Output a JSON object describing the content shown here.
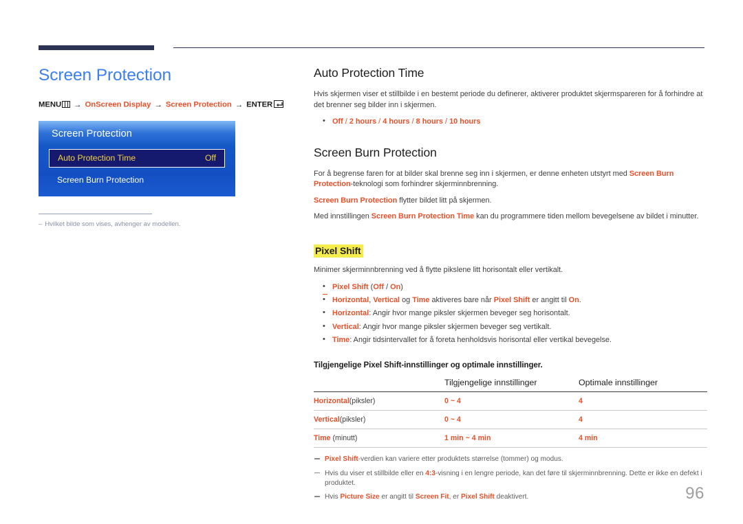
{
  "top_bar": {
    "present": true
  },
  "left": {
    "page_title": "Screen Protection",
    "breadcrumb": {
      "menu_label": "MENU",
      "menu_icon": "menu-bars-icon",
      "arrow1": "→",
      "item1": "OnScreen Display",
      "arrow2": "→",
      "item2": "Screen Protection",
      "arrow3": "→",
      "enter_label": "ENTER",
      "enter_icon": "enter-return-icon"
    },
    "osd": {
      "title": "Screen Protection",
      "rows": [
        {
          "label": "Auto Protection Time",
          "value": "Off",
          "selected": true
        },
        {
          "label": "Screen Burn Protection",
          "value": "",
          "selected": false
        }
      ]
    },
    "note": {
      "dash": "–",
      "text": "Hvilket bilde som vises, avhenger av modellen."
    }
  },
  "right": {
    "section1": {
      "heading": "Auto Protection Time",
      "paragraph": "Hvis skjermen viser et stillbilde i en bestemt periode du definerer, aktiverer produktet skjermspareren for å forhindre at det brenner seg bilder inn i skjermen.",
      "bullet": {
        "opt1": "Off",
        "sep1": " / ",
        "opt2": "2 hours",
        "sep2": " / ",
        "opt3": "4 hours",
        "sep3": " / ",
        "opt4": "8 hours",
        "sep4": " / ",
        "opt5": "10 hours"
      }
    },
    "section2": {
      "heading": "Screen Burn Protection",
      "p1_a": "For å begrense faren for at bilder skal brenne seg inn i skjermen, er denne enheten utstyrt med ",
      "p1_term": "Screen Burn Protection",
      "p1_b": "-teknologi som forhindrer skjerminnbrenning.",
      "p2_term": "Screen Burn Protection",
      "p2_b": " flytter bildet litt på skjermen.",
      "p3_a": "Med innstillingen ",
      "p3_term": "Screen Burn Protection Time",
      "p3_b": " kan du programmere tiden mellom bevegelsene av bildet i minutter."
    },
    "pixel_shift": {
      "heading": "Pixel Shift",
      "intro": "Minimer skjerminnbrenning ved å flytte pikslene litt horisontalt eller vertikalt.",
      "b1_term": "Pixel Shift",
      "b1_paren_open": " (",
      "b1_off": "Off",
      "b1_slash": " / ",
      "b1_on": "On",
      "b1_paren_close": ")",
      "sub_t1": "Horizontal",
      "sub_c1": ", ",
      "sub_t2": "Vertical",
      "sub_mid": " og ",
      "sub_t3": "Time",
      "sub_text": " aktiveres bare når ",
      "sub_t4": "Pixel Shift",
      "sub_text2": " er angitt til ",
      "sub_t5": "On",
      "sub_end": ".",
      "b2_term": "Horizontal",
      "b2_text": ": Angir hvor mange piksler skjermen beveger seg horisontalt.",
      "b3_term": "Vertical",
      "b3_text": ": Angir hvor mange piksler skjermen beveger seg vertikalt.",
      "b4_term": "Time",
      "b4_text": ": Angir tidsintervallet for å foreta henholdsvis horisontal eller vertikal bevegelse."
    },
    "table_lead": "Tilgjengelige Pixel Shift-innstillinger og optimale innstillinger.",
    "table": {
      "headers": [
        "",
        "Tilgjengelige innstillinger",
        "Optimale innstillinger"
      ],
      "rows": [
        {
          "term": "Horizontal",
          "unit": "(piksler)",
          "available": "0 ~ 4",
          "optimal": "4"
        },
        {
          "term": "Vertical",
          "unit": "(piksler)",
          "available": "0 ~ 4",
          "optimal": "4"
        },
        {
          "term": "Time",
          "unit": " (minutt)",
          "available": "1 min ~ 4 min",
          "optimal": "4 min"
        }
      ]
    },
    "footnotes": [
      {
        "t1": "Pixel Shift",
        "rest": "-verdien kan variere etter produktets størrelse (tommer) og modus."
      },
      {
        "a": "Hvis du viser et stillbilde eller en ",
        "t1": "4:3",
        "rest": "-visning i en lengre periode, kan det føre til skjerminnbrenning. Dette er ikke en defekt i produktet."
      },
      {
        "a": "Hvis ",
        "t1": "Picture Size",
        "mid": " er angitt til ",
        "t2": "Screen Fit",
        "mid2": ", er ",
        "t3": "Pixel Shift",
        "rest": " deaktivert."
      }
    ]
  },
  "page_number": "96",
  "colors": {
    "accent_blue": "#3c7ff0",
    "accent_red": "#e8502a",
    "navy_bar": "#2b3255",
    "highlight_yellow": "#f5ec4e",
    "osd_blue": "#1457c6",
    "osd_selected": "#151a6e",
    "osd_selected_text": "#f5d23c",
    "note_grey": "#8b92a8",
    "page_num_grey": "#9e9e9e"
  }
}
